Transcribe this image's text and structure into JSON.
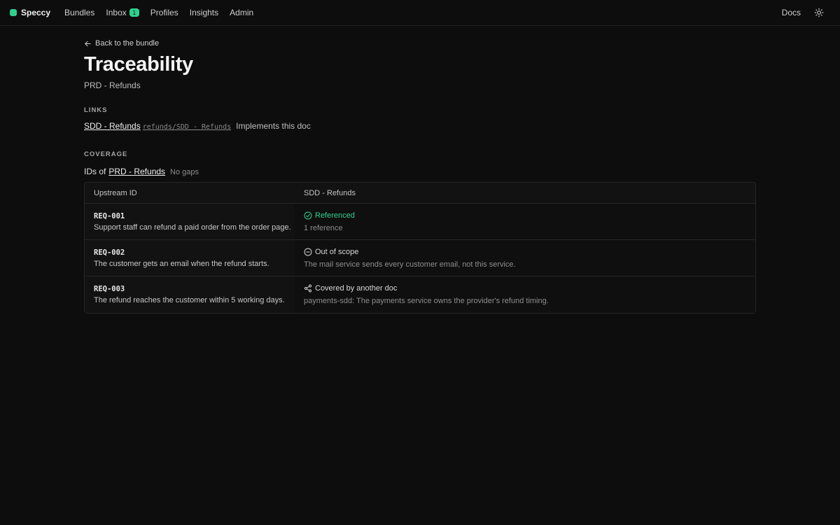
{
  "nav": {
    "brand": "Speccy",
    "items": [
      {
        "label": "Bundles"
      },
      {
        "label": "Inbox",
        "badge": "1"
      },
      {
        "label": "Profiles"
      },
      {
        "label": "Insights"
      },
      {
        "label": "Admin"
      }
    ],
    "docs": "Docs",
    "accent_color": "#2fd08e"
  },
  "page": {
    "back_label": "Back to the bundle",
    "title": "Traceability",
    "subtitle": "PRD - Refunds"
  },
  "links": {
    "section_label": "LINKS",
    "item": {
      "title": "SDD - Refunds",
      "path": "refunds/SDD - Refunds",
      "description": "Implements this doc"
    }
  },
  "coverage": {
    "section_label": "COVERAGE",
    "ids_prefix": "IDs of",
    "ids_doc": "PRD - Refunds",
    "ids_note": "No gaps",
    "table": {
      "headers": [
        "Upstream ID",
        "SDD - Refunds"
      ],
      "rows": [
        {
          "id": "REQ-001",
          "text": "Support staff can refund a paid order from the order page.",
          "status": "Referenced",
          "status_icon": "check-circle-icon",
          "detail": "1 reference"
        },
        {
          "id": "REQ-002",
          "text": "The customer gets an email when the refund starts.",
          "status": "Out of scope",
          "status_icon": "minus-circle-icon",
          "detail": "The mail service sends every customer email, not this service."
        },
        {
          "id": "REQ-003",
          "text": "The refund reaches the customer within 5 working days.",
          "status": "Covered by another doc",
          "status_icon": "share-icon",
          "detail": "payments-sdd: The payments service owns the provider's refund timing."
        }
      ]
    }
  }
}
